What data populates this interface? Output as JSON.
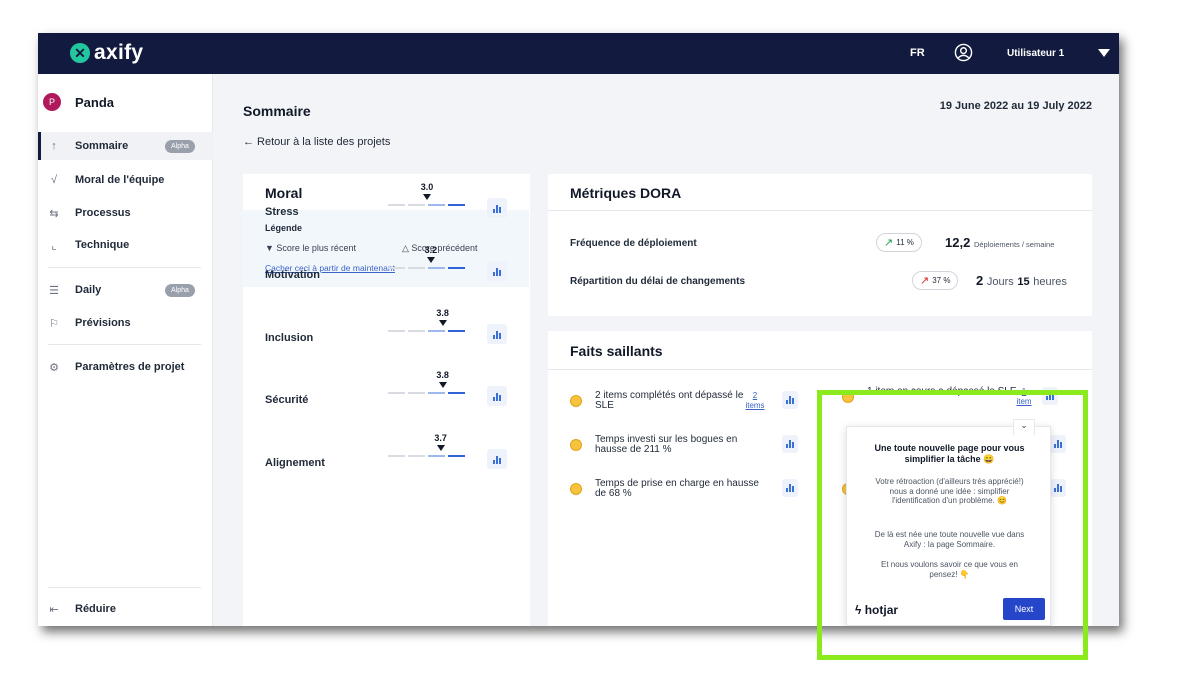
{
  "topbar": {
    "logo_text": "axify",
    "language": "FR",
    "user_name": "Utilisateur 1"
  },
  "sidebar": {
    "project_initial": "P",
    "project_name": "Panda",
    "items": [
      {
        "label": "Sommaire",
        "icon": "pin-icon",
        "badge": "Alpha",
        "active": true
      },
      {
        "label": "Moral de l'équipe",
        "icon": "pulse-icon"
      },
      {
        "label": "Processus",
        "icon": "process-icon"
      },
      {
        "label": "Technique",
        "icon": "trend-chart-icon"
      },
      {
        "label": "Daily",
        "icon": "daily-icon",
        "badge": "Alpha"
      },
      {
        "label": "Prévisions",
        "icon": "flag-icon"
      },
      {
        "label": "Paramètres de projet",
        "icon": "gear-icon"
      }
    ],
    "collapse_label": "Réduire"
  },
  "main": {
    "title": "Sommaire",
    "date_range": "19 June 2022 au 19 July 2022",
    "back_link": "← Retour à la liste des projets"
  },
  "moral": {
    "title": "Moral",
    "legend_title": "Légende",
    "legend_recent": "▼ Score le plus récent",
    "legend_previous": "△ Score précédent",
    "legend_hide": "Cacher ceci à partir de maintenant",
    "rows": [
      {
        "label": "Stress",
        "score": "3.0",
        "value": 3.0
      },
      {
        "label": "Motivation",
        "score": "3.2",
        "value": 3.2
      },
      {
        "label": "Inclusion",
        "score": "3.8",
        "value": 3.8
      },
      {
        "label": "Sécurité",
        "score": "3.8",
        "value": 3.8
      },
      {
        "label": "Alignement",
        "score": "3.7",
        "value": 3.7
      }
    ]
  },
  "dora": {
    "title": "Métriques DORA",
    "deploy_label": "Fréquence de déploiement",
    "deploy_change": "11 %",
    "deploy_value": "12,2",
    "deploy_unit": "Déploiements / semaine",
    "lead_label": "Répartition du délai de changements",
    "lead_change": "37 %",
    "lead_days": "2",
    "lead_days_unit": "Jours",
    "lead_hours": "15",
    "lead_hours_unit": "heures",
    "colors": {
      "positive": "#16a34a",
      "negative": "#dc2626"
    }
  },
  "highlights": {
    "title": "Faits saillants",
    "items": [
      {
        "text": "2 items complétés ont dépassé le SLE",
        "link_num": "2",
        "link_text": "items"
      },
      {
        "text": "Temps investi sur les bogues en hausse de 211 %"
      },
      {
        "text": "Temps de prise en charge en hausse de 68 %"
      },
      {
        "text": "1 item en cours a dépassé le SLE",
        "link_num": "1",
        "link_text": "item"
      }
    ]
  },
  "hotjar": {
    "title": "Une toute nouvelle page pour vous simplifier la tâche 😀",
    "para1": "Votre rétroaction (d'ailleurs très apprécié!) nous a donné une idée : simplifier l'identification d'un problème. 😊",
    "para2": "De là est née une toute nouvelle vue dans Axify : la page Sommaire.",
    "para3": "Et nous voulons savoir ce que vous en pensez! 👇",
    "brand": "hotjar",
    "next_label": "Next"
  }
}
